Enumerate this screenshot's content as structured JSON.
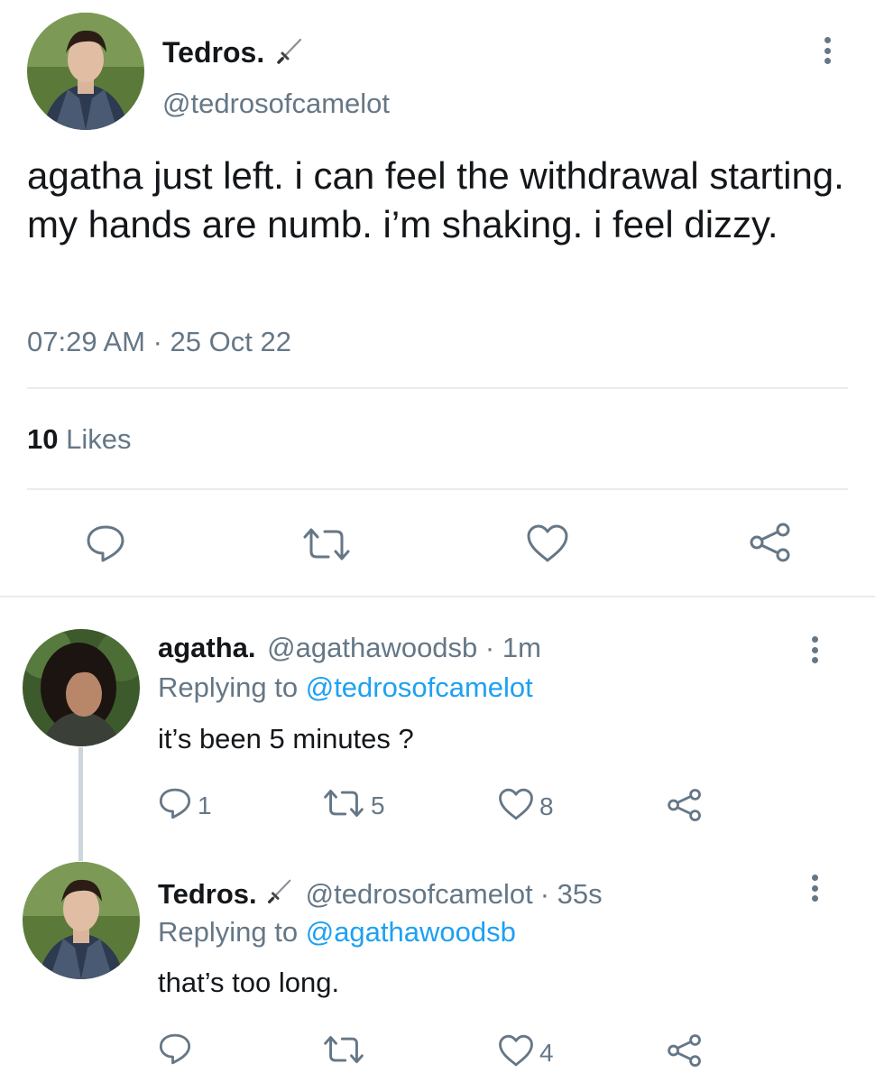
{
  "main_tweet": {
    "display_name": "Tedros.",
    "handle": "@tedrosofcamelot",
    "text": "agatha just left. i can feel the withdrawal starting. my hands are numb. i’m shaking. i feel dizzy.",
    "timestamp": "07:29 AM · 25 Oct 22",
    "likes_count": "10",
    "likes_label": "Likes"
  },
  "replies": [
    {
      "display_name": "agatha.",
      "handle": "@agathawoodsb",
      "time": "· 1m",
      "replying_label": "Replying to",
      "replying_to": "@tedrosofcamelot",
      "text": "it’s been 5 minutes ?",
      "reply_count": "1",
      "retweet_count": "5",
      "like_count": "8"
    },
    {
      "display_name": "Tedros.",
      "handle": "@tedrosofcamelot",
      "time": "· 35s",
      "replying_label": "Replying to",
      "replying_to": "@agathawoodsb",
      "text": "that’s too long.",
      "reply_count": "",
      "retweet_count": "",
      "like_count": "4"
    }
  ],
  "colors": {
    "link": "#1da1f2",
    "secondary_text": "#657786",
    "divider": "#e6ecf0"
  },
  "icons": [
    "reply-icon",
    "retweet-icon",
    "like-icon",
    "share-icon",
    "more-icon",
    "dagger-icon"
  ]
}
